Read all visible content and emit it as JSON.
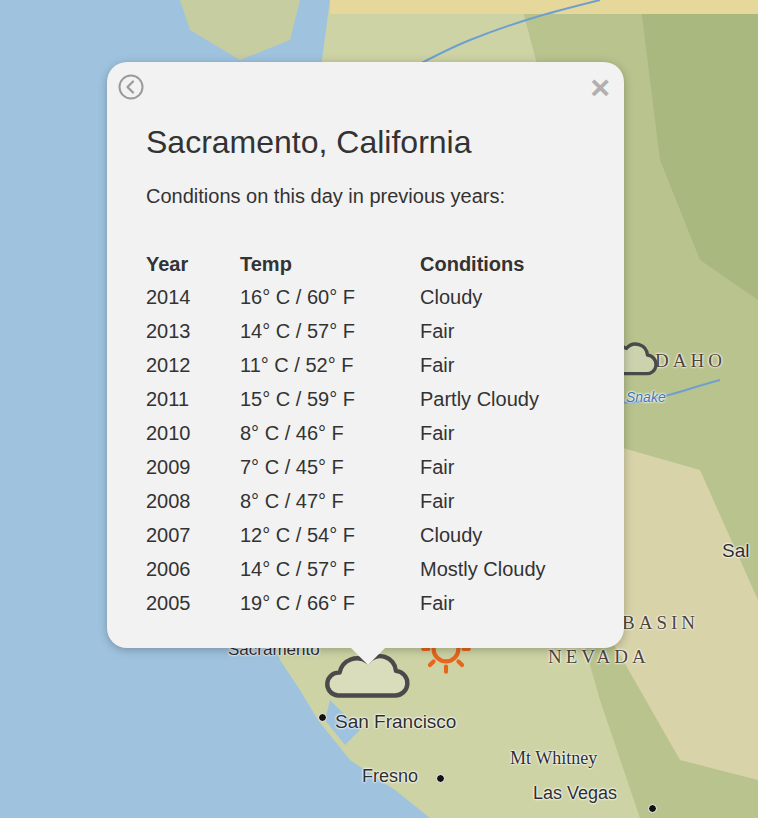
{
  "map": {
    "labels": [
      {
        "text": "Sacramento",
        "kind": "city"
      },
      {
        "text": "San Francisco",
        "kind": "city"
      },
      {
        "text": "Fresno",
        "kind": "city"
      },
      {
        "text": "Mt Whitney",
        "kind": "peak"
      },
      {
        "text": "Las Vegas",
        "kind": "city"
      },
      {
        "text": "NEVADA",
        "kind": "region"
      },
      {
        "text": "BASIN",
        "kind": "region"
      },
      {
        "text": "DAHO",
        "kind": "region"
      },
      {
        "text": "Sal",
        "kind": "city"
      },
      {
        "text": "Snake",
        "kind": "water"
      }
    ],
    "markers": [
      {
        "kind": "cloud"
      },
      {
        "kind": "sun"
      },
      {
        "kind": "cloud"
      }
    ]
  },
  "popup": {
    "close": "×",
    "title": "Sacramento, California",
    "subtitle": "Conditions on this day in previous years:",
    "table": {
      "columns": [
        "Year",
        "Temp",
        "Conditions"
      ],
      "rows": [
        {
          "year": "2014",
          "temp": "16° C / 60° F",
          "conditions": "Cloudy"
        },
        {
          "year": "2013",
          "temp": "14° C / 57° F",
          "conditions": "Fair"
        },
        {
          "year": "2012",
          "temp": "11° C / 52° F",
          "conditions": "Fair"
        },
        {
          "year": "2011",
          "temp": "15° C / 59° F",
          "conditions": "Partly Cloudy"
        },
        {
          "year": "2010",
          "temp": "8° C / 46° F",
          "conditions": "Fair"
        },
        {
          "year": "2009",
          "temp": "7° C / 45° F",
          "conditions": "Fair"
        },
        {
          "year": "2008",
          "temp": "8° C / 47° F",
          "conditions": "Fair"
        },
        {
          "year": "2007",
          "temp": "12° C / 54° F",
          "conditions": "Cloudy"
        },
        {
          "year": "2006",
          "temp": "14° C / 57° F",
          "conditions": "Mostly Cloudy"
        },
        {
          "year": "2005",
          "temp": "19° C / 66° F",
          "conditions": "Fair"
        }
      ]
    }
  }
}
